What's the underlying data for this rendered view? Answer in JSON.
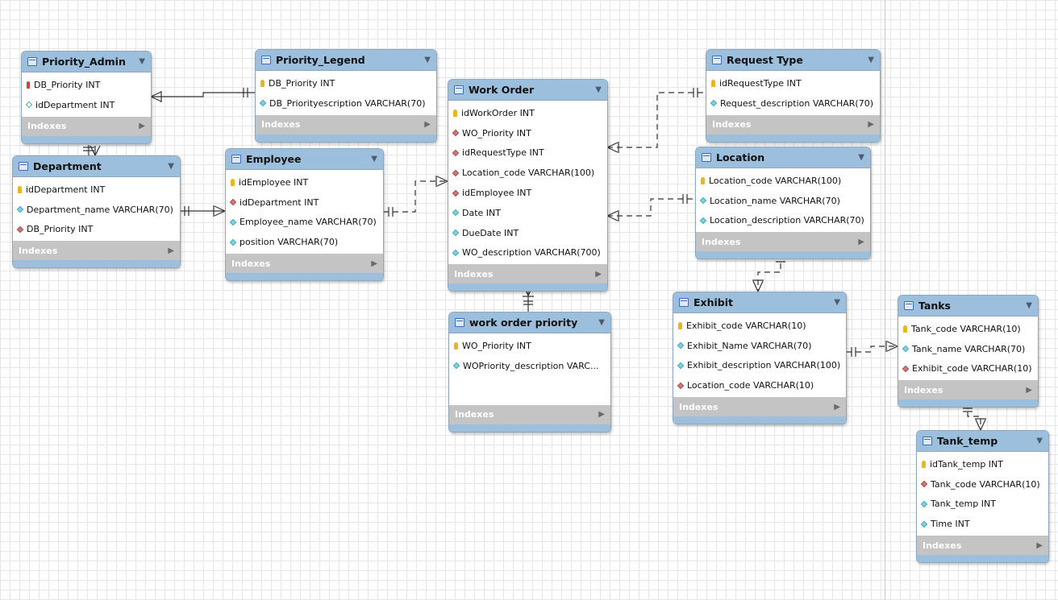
{
  "indexes_label": "Indexes",
  "colors": {
    "header": "#9bbfdc",
    "indexes": "#c4c4c4",
    "grid": "#e6e6e6"
  },
  "entities": {
    "priority_admin": {
      "title": "Priority_Admin",
      "columns": [
        "DB_Priority INT",
        "idDepartment INT"
      ]
    },
    "priority_legend": {
      "title": "Priority_Legend",
      "columns": [
        "DB_Priority INT",
        "DB_Priorityescription VARCHAR(70)"
      ]
    },
    "department": {
      "title": "Department",
      "columns": [
        "idDepartment INT",
        "Department_name VARCHAR(70)",
        "DB_Priority INT"
      ]
    },
    "employee": {
      "title": "Employee",
      "columns": [
        "idEmployee INT",
        "idDepartment INT",
        "Employee_name VARCHAR(70)",
        "position VARCHAR(70)"
      ]
    },
    "work_order": {
      "title": "Work Order",
      "columns": [
        "idWorkOrder INT",
        "WO_Priority INT",
        "idRequestType INT",
        "Location_code VARCHAR(100)",
        "idEmployee INT",
        "Date INT",
        "DueDate INT",
        "WO_description VARCHAR(700)"
      ]
    },
    "work_order_priority": {
      "title": "work order priority",
      "columns": [
        "WO_Priority INT",
        "WOPriority_description VARC..."
      ]
    },
    "request_type": {
      "title": "Request Type",
      "columns": [
        "idRequestType INT",
        "Request_description VARCHAR(70)"
      ]
    },
    "location": {
      "title": "Location",
      "columns": [
        "Location_code VARCHAR(100)",
        "Location_name VARCHAR(70)",
        "Location_description VARCHAR(70)"
      ]
    },
    "exhibit": {
      "title": "Exhibit",
      "columns": [
        "Exhibit_code VARCHAR(10)",
        "Exhibit_Name VARCHAR(70)",
        "Exhibit_description VARCHAR(100)",
        "Location_code VARCHAR(10)"
      ]
    },
    "tanks": {
      "title": "Tanks",
      "columns": [
        "Tank_code VARCHAR(10)",
        "Tank_name VARCHAR(70)",
        "Exhibit_code VARCHAR(10)"
      ]
    },
    "tank_temp": {
      "title": "Tank_temp",
      "columns": [
        "idTank_temp INT",
        "Tank_code VARCHAR(10)",
        "Tank_temp INT",
        "Time INT"
      ]
    }
  }
}
